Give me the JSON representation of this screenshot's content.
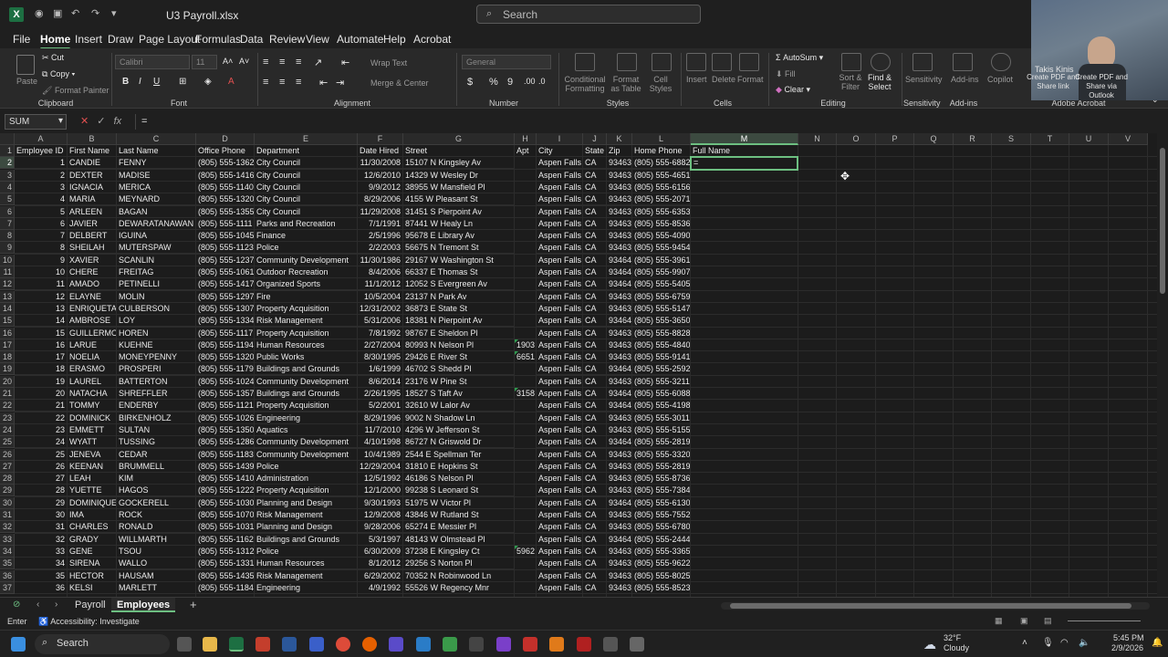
{
  "titlebar": {
    "file_name": "U3 Payroll.xlsx",
    "search_placeholder": "Search"
  },
  "ribbon_tabs": [
    "File",
    "Home",
    "Insert",
    "Draw",
    "Page Layout",
    "Formulas",
    "Data",
    "Review",
    "View",
    "Automate",
    "Help",
    "Acrobat"
  ],
  "ribbon": {
    "paste": "Paste",
    "cut": "Cut",
    "copy": "Copy",
    "format_painter": "Format Painter",
    "clipboard": "Clipboard",
    "font_name": "Calibri",
    "font_size": "11",
    "font": "Font",
    "wrap_text": "Wrap Text",
    "merge_center": "Merge & Center",
    "alignment": "Alignment",
    "number_format": "General",
    "number": "Number",
    "conditional_formatting": "Conditional Formatting",
    "format_as_table": "Format as Table",
    "cell_styles": "Cell Styles",
    "styles": "Styles",
    "insert": "Insert",
    "delete": "Delete",
    "format": "Format",
    "cells": "Cells",
    "autosum": "AutoSum",
    "fill": "Fill",
    "clear": "Clear",
    "sort_filter": "Sort & Filter",
    "find_select": "Find & Select",
    "editing": "Editing",
    "sensitivity": "Sensitivity",
    "addins": "Add-ins",
    "copilot": "Copilot",
    "create_pdf_link": "Create PDF and Share link",
    "create_pdf_outlook": "Create PDF and Share via Outlook",
    "adobe_acrobat": "Adobe Acrobat"
  },
  "webcam_name": "Takis Kinis",
  "formula_bar": {
    "name_box": "SUM",
    "formula": "="
  },
  "columns": [
    "A",
    "B",
    "C",
    "D",
    "E",
    "F",
    "G",
    "H",
    "I",
    "J",
    "K",
    "L",
    "M",
    "N",
    "O",
    "P",
    "Q",
    "R",
    "S",
    "T",
    "U",
    "V"
  ],
  "header_row": [
    "Employee ID",
    "First Name",
    "Last Name",
    "Office Phone",
    "Department",
    "Date Hired",
    "Street",
    "Apt",
    "City",
    "State",
    "Zip",
    "Home Phone",
    "Full Name"
  ],
  "rows": [
    [
      "1",
      "CANDIE",
      "FENNY",
      "(805) 555-1362",
      "City Council",
      "11/30/2008",
      "15107 N Kingsley Av",
      "",
      "Aspen Falls",
      "CA",
      "93463",
      "(805) 555-6882"
    ],
    [
      "2",
      "DEXTER",
      "MADISE",
      "(805) 555-1416",
      "City Council",
      "12/6/2010",
      "14329 W Wesley Dr",
      "",
      "Aspen Falls",
      "CA",
      "93463",
      "(805) 555-4651"
    ],
    [
      "3",
      "IGNACIA",
      "MERICA",
      "(805) 555-1140",
      "City Council",
      "9/9/2012",
      "38955 W Mansfield Pl",
      "",
      "Aspen Falls",
      "CA",
      "93463",
      "(805) 555-6156"
    ],
    [
      "4",
      "MARIA",
      "MEYNARD",
      "(805) 555-1320",
      "City Council",
      "8/29/2006",
      "4155 W Pleasant St",
      "",
      "Aspen Falls",
      "CA",
      "93463",
      "(805) 555-2071"
    ],
    [
      "5",
      "ARLEEN",
      "BAGAN",
      "(805) 555-1355",
      "City Council",
      "11/29/2008",
      "31451 S Pierpoint Av",
      "",
      "Aspen Falls",
      "CA",
      "93463",
      "(805) 555-6353"
    ],
    [
      "6",
      "JAVIER",
      "DEWARATANAWAN",
      "(805) 555-1111",
      "Parks and Recreation",
      "7/1/1991",
      "87441 W Healy Ln",
      "",
      "Aspen Falls",
      "CA",
      "93463",
      "(805) 555-8536"
    ],
    [
      "7",
      "DELBERT",
      "IGUINA",
      "(805) 555-1045",
      "Finance",
      "2/5/1996",
      "95678 E Library Av",
      "",
      "Aspen Falls",
      "CA",
      "93463",
      "(805) 555-4090"
    ],
    [
      "8",
      "SHEILAH",
      "MUTERSPAW",
      "(805) 555-1123",
      "Police",
      "2/2/2003",
      "56675 N Tremont St",
      "",
      "Aspen Falls",
      "CA",
      "93463",
      "(805) 555-9454"
    ],
    [
      "9",
      "XAVIER",
      "SCANLIN",
      "(805) 555-1237",
      "Community Development",
      "11/30/1986",
      "29167 W Washington St",
      "",
      "Aspen Falls",
      "CA",
      "93464",
      "(805) 555-3961"
    ],
    [
      "10",
      "CHERE",
      "FREITAG",
      "(805) 555-1061",
      "Outdoor Recreation",
      "8/4/2006",
      "66337 E Thomas St",
      "",
      "Aspen Falls",
      "CA",
      "93464",
      "(805) 555-9907"
    ],
    [
      "11",
      "AMADO",
      "PETINELLI",
      "(805) 555-1417",
      "Organized Sports",
      "11/1/2012",
      "12052 S Evergreen Av",
      "",
      "Aspen Falls",
      "CA",
      "93464",
      "(805) 555-5405"
    ],
    [
      "12",
      "ELAYNE",
      "MOLIN",
      "(805) 555-1297",
      "Fire",
      "10/5/2004",
      "23137 N Park Av",
      "",
      "Aspen Falls",
      "CA",
      "93463",
      "(805) 555-6759"
    ],
    [
      "13",
      "ENRIQUETA",
      "CULBERSON",
      "(805) 555-1307",
      "Property Acquisition",
      "12/31/2002",
      "36873 E State St",
      "",
      "Aspen Falls",
      "CA",
      "93463",
      "(805) 555-5147"
    ],
    [
      "14",
      "AMBROSE",
      "LOY",
      "(805) 555-1334",
      "Risk Management",
      "5/31/2006",
      "18381 N Pierpoint Av",
      "",
      "Aspen Falls",
      "CA",
      "93464",
      "(805) 555-3650"
    ],
    [
      "15",
      "GUILLERMO",
      "HOREN",
      "(805) 555-1117",
      "Property Acquisition",
      "7/8/1992",
      "98767 E Sheldon Pl",
      "",
      "Aspen Falls",
      "CA",
      "93463",
      "(805) 555-8828"
    ],
    [
      "16",
      "LARUE",
      "KUEHNE",
      "(805) 555-1194",
      "Human Resources",
      "2/27/2004",
      "80993 N Nelson Pl",
      "1903",
      "Aspen Falls",
      "CA",
      "93463",
      "(805) 555-4840"
    ],
    [
      "17",
      "NOELIA",
      "MONEYPENNY",
      "(805) 555-1320",
      "Public Works",
      "8/30/1995",
      "29426 E River St",
      "6651",
      "Aspen Falls",
      "CA",
      "93463",
      "(805) 555-9141"
    ],
    [
      "18",
      "ERASMO",
      "PROSPERI",
      "(805) 555-1179",
      "Buildings and Grounds",
      "1/6/1999",
      "46702 S Shedd Pl",
      "",
      "Aspen Falls",
      "CA",
      "93464",
      "(805) 555-2592"
    ],
    [
      "19",
      "LAUREL",
      "BATTERTON",
      "(805) 555-1024",
      "Community Development",
      "8/6/2014",
      "23176 W Pine St",
      "",
      "Aspen Falls",
      "CA",
      "93463",
      "(805) 555-3211"
    ],
    [
      "20",
      "NATACHA",
      "SHREFFLER",
      "(805) 555-1357",
      "Buildings and Grounds",
      "2/26/1995",
      "18527 S Taft Av",
      "3158",
      "Aspen Falls",
      "CA",
      "93464",
      "(805) 555-6088"
    ],
    [
      "21",
      "TOMMY",
      "ENDERBY",
      "(805) 555-1121",
      "Property Acquisition",
      "5/2/2001",
      "32610 W Lalor Av",
      "",
      "Aspen Falls",
      "CA",
      "93464",
      "(805) 555-4198"
    ],
    [
      "22",
      "DOMINICK",
      "BIRKENHOLZ",
      "(805) 555-1026",
      "Engineering",
      "8/29/1996",
      "9002 N Shadow Ln",
      "",
      "Aspen Falls",
      "CA",
      "93463",
      "(805) 555-3011"
    ],
    [
      "23",
      "EMMETT",
      "SULTAN",
      "(805) 555-1350",
      "Aquatics",
      "11/7/2010",
      "4296 W Jefferson St",
      "",
      "Aspen Falls",
      "CA",
      "93463",
      "(805) 555-5155"
    ],
    [
      "24",
      "WYATT",
      "TUSSING",
      "(805) 555-1286",
      "Community Development",
      "4/10/1998",
      "86727 N Griswold Dr",
      "",
      "Aspen Falls",
      "CA",
      "93464",
      "(805) 555-2819"
    ],
    [
      "25",
      "JENEVA",
      "CEDAR",
      "(805) 555-1183",
      "Community Development",
      "10/4/1989",
      "2544 E Spellman Ter",
      "",
      "Aspen Falls",
      "CA",
      "93463",
      "(805) 555-3320"
    ],
    [
      "26",
      "KEENAN",
      "BRUMMELL",
      "(805) 555-1439",
      "Police",
      "12/29/2004",
      "31810 E Hopkins St",
      "",
      "Aspen Falls",
      "CA",
      "93463",
      "(805) 555-2819"
    ],
    [
      "27",
      "LEAH",
      "KIM",
      "(805) 555-1410",
      "Administration",
      "12/5/1992",
      "46186 S Nelson Pl",
      "",
      "Aspen Falls",
      "CA",
      "93463",
      "(805) 555-8736"
    ],
    [
      "28",
      "YUETTE",
      "HAGOS",
      "(805) 555-1222",
      "Property Acquisition",
      "12/1/2000",
      "99238 S Leonard St",
      "",
      "Aspen Falls",
      "CA",
      "93463",
      "(805) 555-7384"
    ],
    [
      "29",
      "DOMINIQUE",
      "GOCKERELL",
      "(805) 555-1030",
      "Planning and Design",
      "9/30/1993",
      "51975 W Victor Pl",
      "",
      "Aspen Falls",
      "CA",
      "93464",
      "(805) 555-6130"
    ],
    [
      "30",
      "IMA",
      "ROCK",
      "(805) 555-1070",
      "Risk Management",
      "12/9/2008",
      "43846 W Rutland St",
      "",
      "Aspen Falls",
      "CA",
      "93463",
      "(805) 555-7552"
    ],
    [
      "31",
      "CHARLES",
      "RONALD",
      "(805) 555-1031",
      "Planning and Design",
      "9/28/2006",
      "65274 E Messier Pl",
      "",
      "Aspen Falls",
      "CA",
      "93463",
      "(805) 555-6780"
    ],
    [
      "32",
      "GRADY",
      "WILLMARTH",
      "(805) 555-1162",
      "Buildings and Grounds",
      "5/3/1997",
      "48143 W Olmstead Pl",
      "",
      "Aspen Falls",
      "CA",
      "93464",
      "(805) 555-2444"
    ],
    [
      "33",
      "GENE",
      "TSOU",
      "(805) 555-1312",
      "Police",
      "6/30/2009",
      "37238 E Kingsley Ct",
      "5962",
      "Aspen Falls",
      "CA",
      "93463",
      "(805) 555-3365"
    ],
    [
      "34",
      "SIRENA",
      "WALLO",
      "(805) 555-1331",
      "Human Resources",
      "8/1/2012",
      "29256 S Norton Pl",
      "",
      "Aspen Falls",
      "CA",
      "93463",
      "(805) 555-9622"
    ],
    [
      "35",
      "HECTOR",
      "HAUSAM",
      "(805) 555-1435",
      "Risk Management",
      "6/29/2002",
      "70352 N Robinwood Ln",
      "",
      "Aspen Falls",
      "CA",
      "93463",
      "(805) 555-8025"
    ],
    [
      "36",
      "KELSI",
      "MARLETT",
      "(805) 555-1184",
      "Engineering",
      "4/9/1992",
      "55526 W Regency Mnr",
      "",
      "Aspen Falls",
      "CA",
      "93463",
      "(805) 555-8523"
    ]
  ],
  "active_cell_value": "=",
  "sheets": [
    "Payroll",
    "Employees"
  ],
  "status": {
    "mode": "Enter",
    "accessibility": "Accessibility: Investigate"
  },
  "taskbar": {
    "search": "Search",
    "temp": "32°F",
    "weather": "Cloudy",
    "time": "5:45 PM",
    "date": "2/9/2026"
  },
  "colors": {
    "accent": "#6dbf81",
    "excel_green": "#1d6f42"
  }
}
